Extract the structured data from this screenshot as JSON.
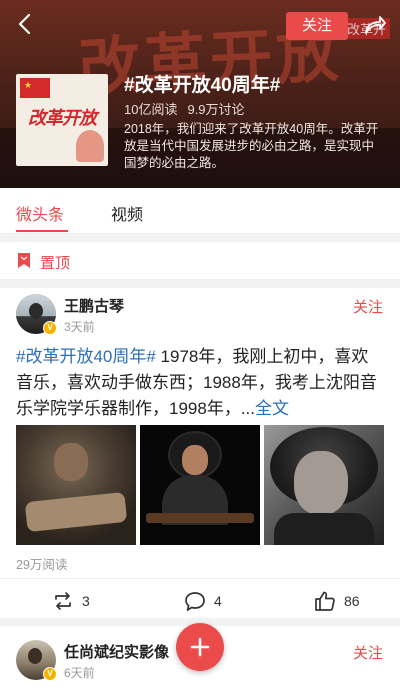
{
  "header": {
    "background_text": "改革开放",
    "background_tag": "改革开",
    "follow_label": "关注",
    "cover_text": "改革开放",
    "title": "#改革开放40周年#",
    "reads": "10亿阅读",
    "discussions": "9.9万讨论",
    "description": "2018年，我们迎来了改革开放40周年。改革开放是当代中国发展进步的必由之路，是实现中国梦的必由之路。"
  },
  "tabs": [
    {
      "label": "微头条",
      "active": true
    },
    {
      "label": "视频",
      "active": false
    }
  ],
  "pinned": {
    "label": "置顶"
  },
  "posts": [
    {
      "author": "王鹏古琴",
      "time": "3天前",
      "follow_label": "关注",
      "hashtag": "#改革开放40周年#",
      "text": " 1978年，我刚上初中，喜欢音乐，喜欢动手做东西；1988年，我考上沈阳音乐学院学乐器制作，1998年，...",
      "more": "全文",
      "reads": "29万阅读",
      "actions": {
        "repost": "3",
        "comment": "4",
        "like": "86"
      }
    },
    {
      "author": "任尚斌纪实影像",
      "time": "6天前",
      "follow_label": "关注"
    }
  ],
  "colors": {
    "accent": "#e94a4a",
    "link": "#2b6fb6",
    "verified": "#f5b301"
  },
  "icons": [
    "back-arrow-icon",
    "share-icon",
    "bookmark-icon",
    "verified-icon",
    "repost-icon",
    "comment-icon",
    "like-icon",
    "plus-icon"
  ]
}
